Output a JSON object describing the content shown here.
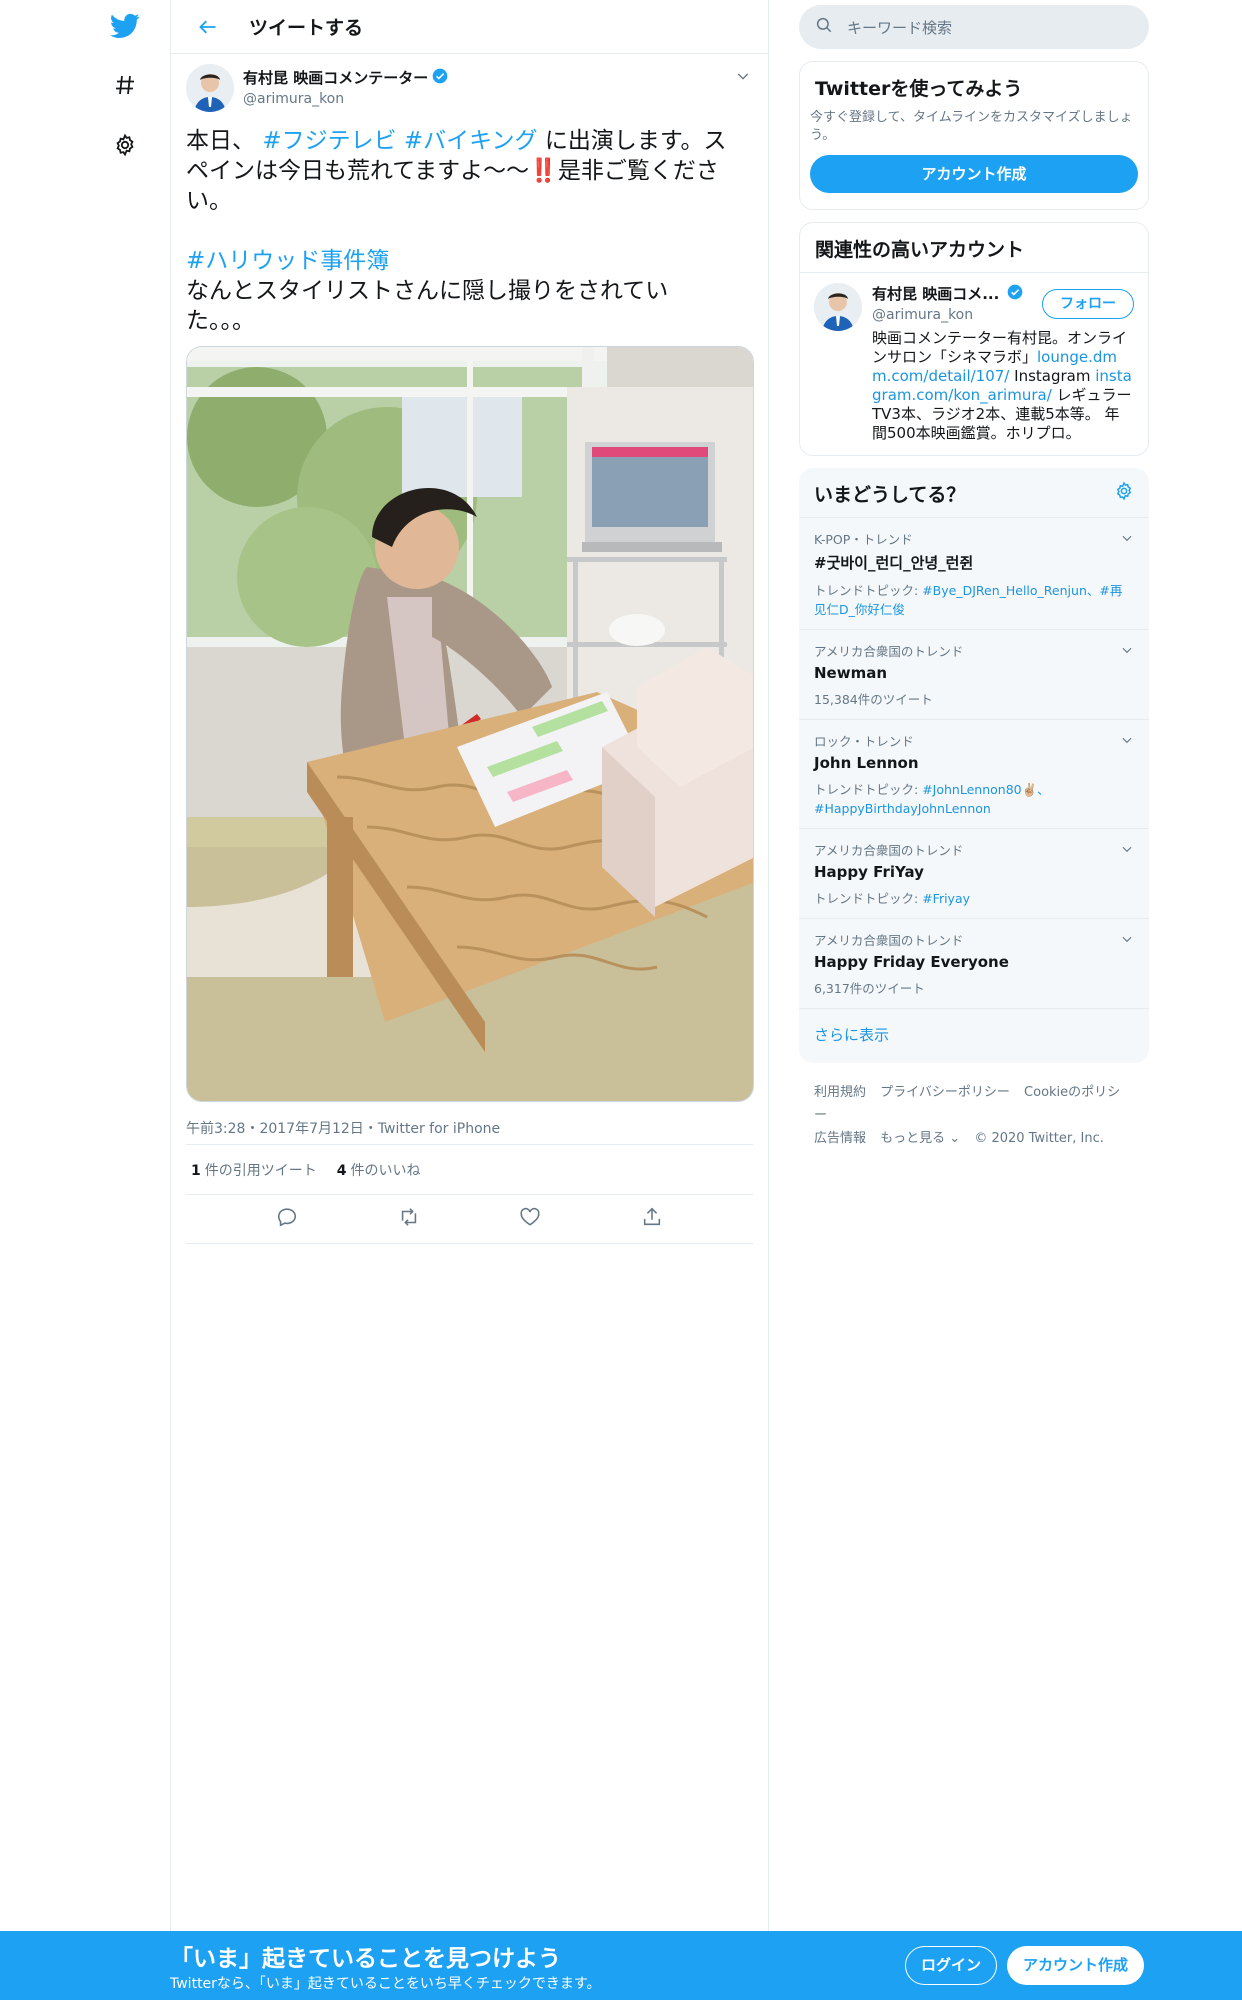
{
  "header": {
    "title": "ツイートする"
  },
  "tweet": {
    "author_name": "有村昆 映画コメンテーター",
    "author_handle": "@arimura_kon",
    "text_1_pre": "本日、",
    "hashtag_1": "#フジテレビ",
    "hashtag_2": "#バイキング",
    "text_1_post": "に出演します。スペインは今日も荒れてますよ〜〜",
    "emoji": "‼️",
    "text_1_end": "是非ご覧ください。",
    "hashtag_3": "#ハリウッド事件簿",
    "text_2": "なんとスタイリストさんに隠し撮りをされていた。。。",
    "meta": "午前3:28・2017年7月12日・Twitter for iPhone",
    "quote_count": "1",
    "quote_label": "件の引用ツイート",
    "like_count": "4",
    "like_label": "件のいいね"
  },
  "search": {
    "placeholder": "キーワード検索"
  },
  "signup_panel": {
    "title": "Twitterを使ってみよう",
    "desc": "今すぐ登録して、タイムラインをカスタマイズしましょう。",
    "button": "アカウント作成"
  },
  "related": {
    "title": "関連性の高いアカウント",
    "name": "有村昆 映画コメ...",
    "handle": "@arimura_kon",
    "follow": "フォロー",
    "bio_1": "映画コメンテーター有村昆。オンラインサロン「シネマラボ」",
    "bio_link_1": "lounge.dmm.com/detail/107/",
    "bio_2": " Instagram ",
    "bio_link_2": "instagram.com/kon_arimura/",
    "bio_3": " レギュラーTV3本、ラジオ2本、連載5本等。 年間500本映画鑑賞。ホリプロ。"
  },
  "trends": {
    "title": "いまどうしてる？",
    "items": [
      {
        "context": "K-POP・トレンド",
        "name": "#굿바이_런디_안녕_런쥔",
        "sub_prefix": "トレンドトピック: ",
        "sub_link": "#Bye_DJRen_Hello_Renjun、#再见仁D_你好仁俊",
        "sub_plain": ""
      },
      {
        "context": "アメリカ合衆国のトレンド",
        "name": "Newman",
        "sub_prefix": "",
        "sub_link": "",
        "sub_plain": "15,384件のツイート"
      },
      {
        "context": "ロック・トレンド",
        "name": "John Lennon",
        "sub_prefix": "トレンドトピック: ",
        "sub_link": "#JohnLennon80✌🏼、#HappyBirthdayJohnLennon",
        "sub_plain": ""
      },
      {
        "context": "アメリカ合衆国のトレンド",
        "name": "Happy FriYay",
        "sub_prefix": "トレンドトピック: ",
        "sub_link": "#Friyay",
        "sub_plain": ""
      },
      {
        "context": "アメリカ合衆国のトレンド",
        "name": "Happy Friday Everyone",
        "sub_prefix": "",
        "sub_link": "",
        "sub_plain": "6,317件のツイート"
      }
    ],
    "show_more": "さらに表示"
  },
  "footer": {
    "terms": "利用規約",
    "privacy": "プライバシーポリシー",
    "cookie": "Cookieのポリシー",
    "ads": "広告情報",
    "more": "もっと見る ⌄",
    "copyright": "© 2020 Twitter, Inc."
  },
  "bottom_bar": {
    "title": "「いま」起きていることを見つけよう",
    "subtitle": "Twitterなら、「いま」起きていることをいち早くチェックできます。",
    "login": "ログイン",
    "signup": "アカウント作成"
  },
  "colors": {
    "brand": "#1da1f2",
    "link": "#1b95e0",
    "muted": "#657786",
    "border": "#e6ecf0"
  }
}
